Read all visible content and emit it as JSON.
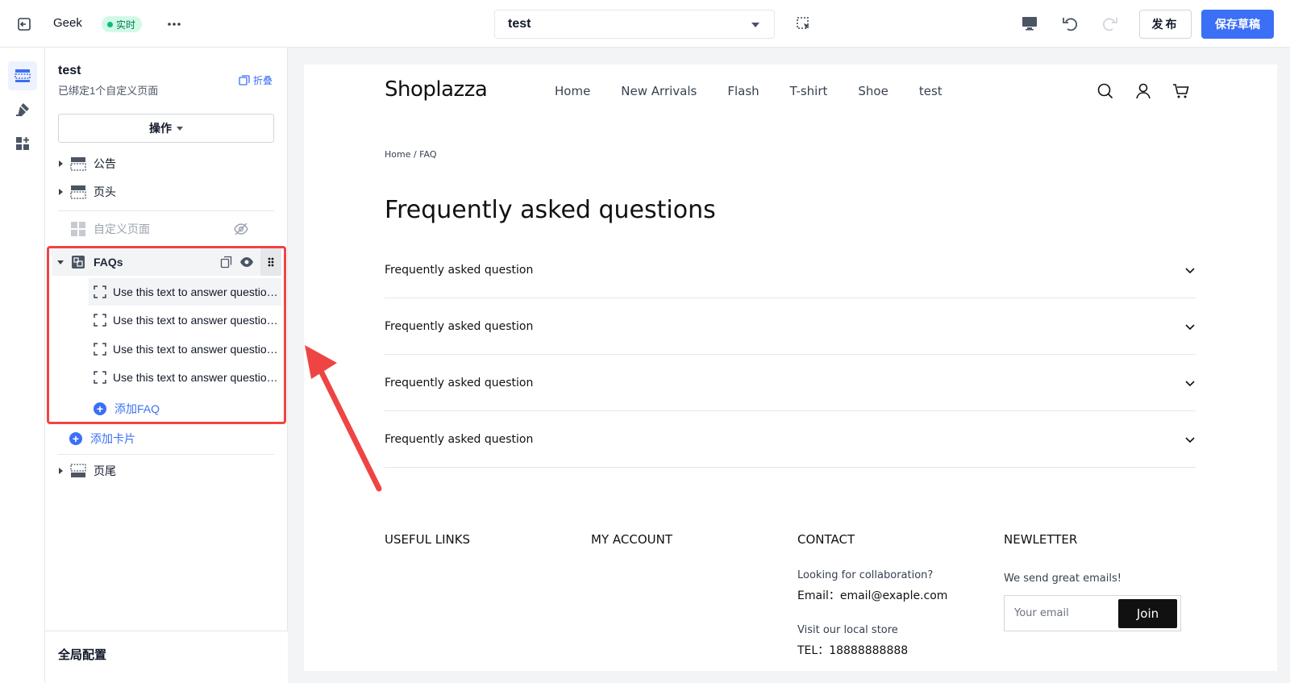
{
  "topbar": {
    "shop_name": "Geek",
    "live_badge": "实时",
    "page_selector_value": "test",
    "publish_label": "发布",
    "save_draft_label": "保存草稿"
  },
  "panel": {
    "title": "test",
    "subtitle": "已绑定1个自定义页面",
    "collapse_label": "折叠",
    "operations_label": "操作",
    "sections": {
      "announcement": "公告",
      "header": "页头",
      "custom_page": "自定义页面",
      "faqs": "FAQs",
      "footer": "页尾"
    },
    "faq_items": [
      "Use this text to answer questions",
      "Use this text to answer questions",
      "Use this text to answer questions",
      "Use this text to answer questions"
    ],
    "add_faq_label": "添加FAQ",
    "add_card_label": "添加卡片",
    "global_config_label": "全局配置"
  },
  "preview": {
    "logo": "Shoplazza",
    "nav": [
      "Home",
      "New Arrivals",
      "Flash",
      "T-shirt",
      "Shoe",
      "test"
    ],
    "breadcrumb": "Home / FAQ",
    "heading": "Frequently asked questions",
    "questions": [
      "Frequently asked question",
      "Frequently asked question",
      "Frequently asked question",
      "Frequently asked question"
    ],
    "footer": {
      "useful_links": "USEFUL LINKS",
      "my_account": "MY ACCOUNT",
      "contact": "CONTACT",
      "newsletter": "NEWLETTER",
      "collab_text": "Looking for collaboration?",
      "email_line": "Email：email@exaple.com",
      "visit_text": "Visit our local store",
      "tel_line": "TEL：18888888888",
      "newsletter_text": "We send great emails!",
      "email_placeholder": "Your email",
      "join_label": "Join"
    }
  },
  "colors": {
    "accent": "#3b6ff5",
    "live_green": "#10b981",
    "annotation_red": "#ef4444"
  }
}
